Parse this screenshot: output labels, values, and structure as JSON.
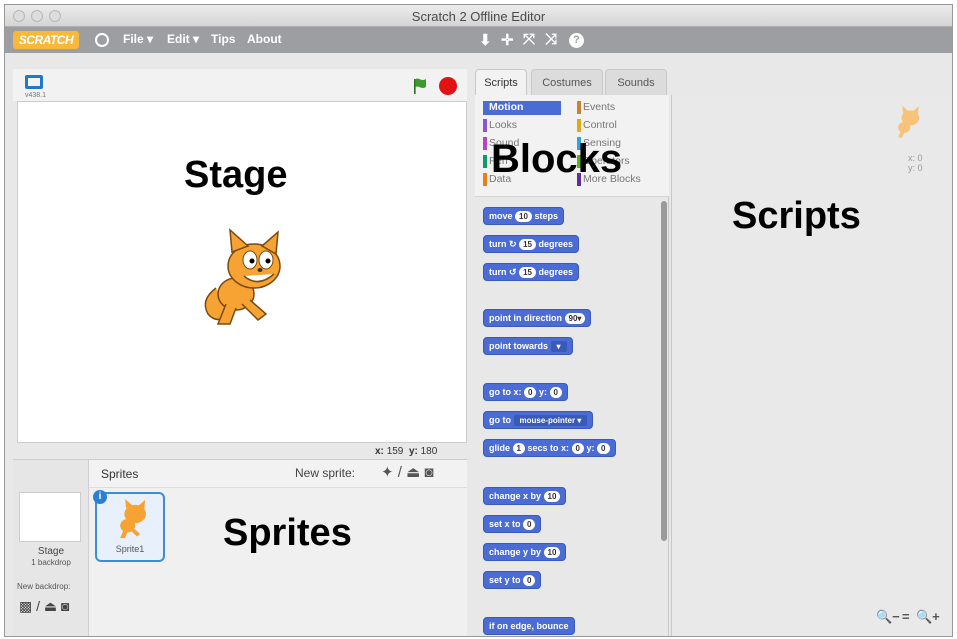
{
  "window": {
    "title": "Scratch 2 Offline Editor"
  },
  "menubar": {
    "logo": "SCRATCH",
    "items": [
      "File ▾",
      "Edit ▾",
      "Tips",
      "About"
    ],
    "tools": [
      "⬇",
      "✛",
      "⤧",
      "⤨",
      "?"
    ]
  },
  "stage": {
    "version": "v438.1",
    "overlay_label": "Stage",
    "coords": {
      "x_label": "x:",
      "x": "159",
      "y_label": "y:",
      "y": "180"
    }
  },
  "sprites_pane": {
    "title": "Sprites",
    "new_sprite_label": "New sprite:",
    "overlay_label": "Sprites",
    "stage_name": "Stage",
    "stage_backdrops": "1 backdrop",
    "new_backdrop_label": "New backdrop:",
    "sprite_name": "Sprite1"
  },
  "tabs": [
    "Scripts",
    "Costumes",
    "Sounds"
  ],
  "categories": {
    "left": [
      "Motion",
      "Looks",
      "Sound",
      "Pen",
      "Data"
    ],
    "right": [
      "Events",
      "Control",
      "Sensing",
      "Operators",
      "More Blocks"
    ],
    "overlay_label": "Blocks"
  },
  "blocks": [
    {
      "text": "move",
      "input": "10",
      "after": "steps"
    },
    {
      "text": "turn ↻",
      "input": "15",
      "after": "degrees"
    },
    {
      "text": "turn ↺",
      "input": "15",
      "after": "degrees"
    },
    {
      "text": "point in direction",
      "input": "90▾",
      "after": ""
    },
    {
      "text": "point towards",
      "dropdown": "▾",
      "after": ""
    },
    {
      "text": "go to x:",
      "input": "0",
      "after": "y:",
      "input2": "0"
    },
    {
      "text": "go to",
      "dropdown": "mouse-pointer ▾",
      "after": ""
    },
    {
      "text": "glide",
      "input": "1",
      "after": "secs to x:",
      "input2": "0",
      "after2": "y:",
      "input3": "0"
    },
    {
      "text": "change x by",
      "input": "10",
      "after": ""
    },
    {
      "text": "set x to",
      "input": "0",
      "after": ""
    },
    {
      "text": "change y by",
      "input": "10",
      "after": ""
    },
    {
      "text": "set y to",
      "input": "0",
      "after": ""
    },
    {
      "text": "if on edge, bounce",
      "after": ""
    }
  ],
  "scripts_area": {
    "overlay_label": "Scripts",
    "x": "x: 0",
    "y": "y: 0",
    "zoom": [
      "🔍−",
      "=",
      "🔍+"
    ]
  },
  "colors": {
    "motion": "#4a6cd4",
    "looks": "#8a55d7",
    "sound": "#bb42c3",
    "pen": "#0e9a6c",
    "data": "#ee7d16",
    "events": "#c88330",
    "control": "#e1a91a",
    "sensing": "#2ca5e2",
    "operators": "#5cb712",
    "more": "#632d99"
  }
}
